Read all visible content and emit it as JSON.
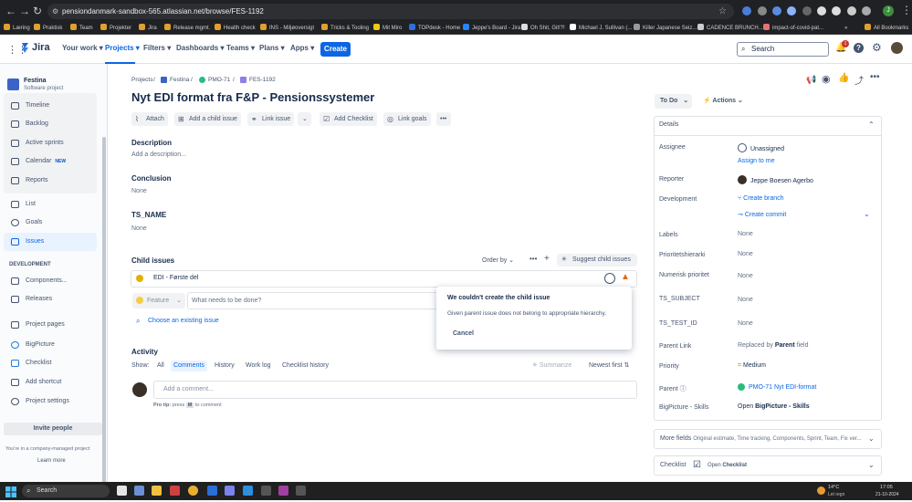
{
  "browser": {
    "url": "pensiondanmark-sandbox-565.atlassian.net/browse/FES-1192",
    "bookmarks": [
      "Læring",
      "Praktisk",
      "Team",
      "Projekter",
      "Jira",
      "Release mgmt.",
      "Health check",
      "INS - Miljøoversigt",
      "Tricks & Tooling",
      "Mit Miro",
      "TOPdesk - Home",
      "Jeppe's Board - Jira",
      "Oh Shit, Git!?!",
      "Michael J. Sullivan (...",
      "Killer Japanese Seiz...",
      "CADENCE BRUNCH...",
      "impact-of-covid-pat..."
    ],
    "all_bookmarks": "All Bookmarks",
    "profile_initial": "J"
  },
  "topnav": {
    "logo": "Jira",
    "items": [
      "Your work",
      "Projects",
      "Filters",
      "Dashboards",
      "Teams",
      "Plans",
      "Apps"
    ],
    "create": "Create",
    "search_placeholder": "Search",
    "notification_count": "1"
  },
  "sidebar": {
    "project_name": "Festina",
    "project_type": "Software project",
    "planning": [
      "Timeline",
      "Backlog",
      "Active sprints",
      "Calendar",
      "Reports"
    ],
    "calendar_badge": "NEW",
    "items": [
      "List",
      "Goals",
      "Issues"
    ],
    "development_header": "DEVELOPMENT",
    "dev_items": [
      "Components...",
      "Releases"
    ],
    "other_items": [
      "Project pages",
      "BigPicture",
      "Checklist",
      "Add shortcut",
      "Project settings"
    ],
    "invite": "Invite people",
    "managed_text": "You're in a company-managed project",
    "learn_more": "Learn more"
  },
  "issue": {
    "breadcrumbs": [
      "Projects",
      "Festina",
      "PMO-71",
      "FES-1192"
    ],
    "title": "Nyt EDI format fra F&P - Pensionssystemer",
    "toolbar": [
      "Attach",
      "Add a child issue",
      "Link issue",
      "Add Checklist",
      "Link goals"
    ],
    "description_label": "Description",
    "description_placeholder": "Add a description...",
    "conclusion_label": "Conclusion",
    "conclusion_value": "None",
    "ts_name_label": "TS_NAME",
    "ts_name_value": "None",
    "child_issues_label": "Child issues",
    "order_by": "Order by",
    "suggest": "Suggest child issues",
    "child_issue": "EDI - Første del",
    "create_type": "Feature",
    "create_placeholder": "What needs to be done?",
    "choose_existing": "Choose an existing issue",
    "popup": {
      "title": "We couldn't create the child issue",
      "message": "Given parent issue does not belong to appropriate hierarchy.",
      "cancel": "Cancel"
    },
    "activity_label": "Activity",
    "show_label": "Show:",
    "activity_tabs": [
      "All",
      "Comments",
      "History",
      "Work log",
      "Checklist history"
    ],
    "summarize": "Summarize",
    "newest_first": "Newest first",
    "comment_placeholder": "Add a comment...",
    "pro_tip_prefix": "Pro tip:",
    "pro_tip_press": "press",
    "pro_tip_key": "M",
    "pro_tip_suffix": "to comment"
  },
  "details": {
    "status": "To Do",
    "actions": "Actions",
    "header": "Details",
    "fields": {
      "assignee_label": "Assignee",
      "assignee_value": "Unassigned",
      "assign_to_me": "Assign to me",
      "reporter_label": "Reporter",
      "reporter_value": "Jeppe Boesen Agerbo",
      "development_label": "Development",
      "create_branch": "Create branch",
      "create_commit": "Create commit",
      "labels_label": "Labels",
      "labels_value": "None",
      "prio_hier_label": "Prioritetshierarki",
      "prio_hier_value": "None",
      "num_prio_label": "Numerisk prioritet",
      "num_prio_value": "None",
      "ts_subject_label": "TS_SUBJECT",
      "ts_subject_value": "None",
      "ts_test_id_label": "TS_TEST_ID",
      "ts_test_id_value": "None",
      "parent_link_label": "Parent Link",
      "parent_link_prefix": "Replaced by",
      "parent_link_bold": "Parent",
      "parent_link_suffix": "field",
      "priority_label": "Priority",
      "priority_value": "Medium",
      "parent_label": "Parent",
      "parent_value": "PMO-71 Nyt EDI-format",
      "bigpicture_label": "BigPicture - Skills",
      "bigpicture_prefix": "Open",
      "bigpicture_bold": "BigPicture - Skills"
    },
    "more_fields_label": "More fields",
    "more_fields_value": "Original estimate, Time tracking, Components, Sprint, Team, Fix ver...",
    "checklist_label": "Checklist",
    "checklist_prefix": "Open",
    "checklist_bold": "Checklist"
  },
  "taskbar": {
    "search": "Search",
    "temperature": "14°C",
    "weather": "Let regn",
    "time": "17:05",
    "date": "21-10-2024"
  }
}
